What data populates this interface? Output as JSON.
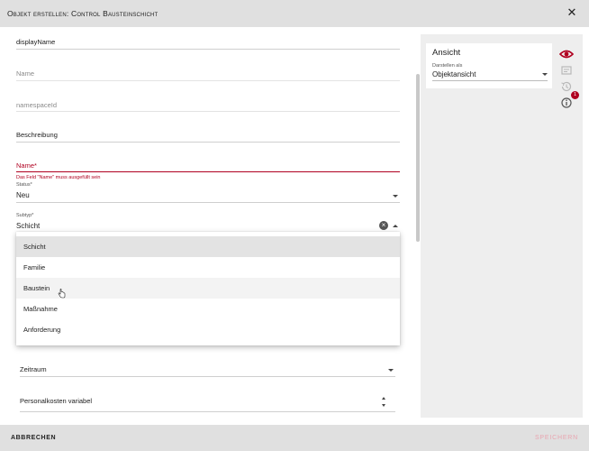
{
  "dialog": {
    "title": "Objekt erstellen: Control Bausteinschicht"
  },
  "form": {
    "display_name": {
      "label": "displayName"
    },
    "name": {
      "label": "Name"
    },
    "namespace_id": {
      "label": "namespaceId"
    },
    "description": {
      "label": "Beschreibung"
    },
    "name_required": {
      "label": "Name*",
      "error": "Das Feld \"Name\" muss ausgefüllt sein"
    },
    "status": {
      "label": "Status*",
      "value": "Neu"
    },
    "subtype": {
      "label": "Subtyp*",
      "value": "Schicht",
      "options": [
        "Schicht",
        "Familie",
        "Baustein",
        "Maßnahme",
        "Anforderung"
      ],
      "selected_option": "Schicht",
      "hovered_option": "Baustein"
    },
    "timeframe": {
      "label": "Zeitraum"
    },
    "personnel_costs": {
      "label": "Personalkosten variabel"
    }
  },
  "right_panel": {
    "title": "Ansicht",
    "display_as_label": "Darstellen als",
    "display_as_value": "Objektansicht",
    "info_badge": "1"
  },
  "footer": {
    "cancel_label": "Abbrechen",
    "save_label": "Speichern"
  },
  "colors": {
    "accent": "#b00020",
    "header_bg": "#e0e0e0",
    "panel_bg": "#eeeeee"
  },
  "icons": {
    "close": "close-icon",
    "view": "eye-icon",
    "linked": "card-icon",
    "history": "history-icon",
    "info": "info-icon"
  }
}
